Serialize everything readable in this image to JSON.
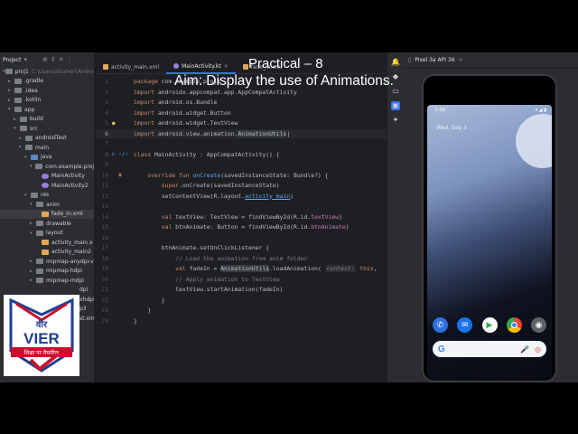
{
  "overlay": {
    "title": "Practical – 8",
    "aim": "Aim: Display the use of Animations."
  },
  "project_panel": {
    "header": "Project",
    "tree": [
      {
        "label": "proj1",
        "path": "C:\\Users\\shaheri\\AndroidS",
        "icon": "folder",
        "depth": 0,
        "expanded": true
      },
      {
        "label": ".gradle",
        "icon": "folder",
        "depth": 1
      },
      {
        "label": ".idea",
        "icon": "folder",
        "depth": 1
      },
      {
        "label": ".kotlin",
        "icon": "folder",
        "depth": 1
      },
      {
        "label": "app",
        "icon": "folder",
        "depth": 1,
        "expanded": true
      },
      {
        "label": "build",
        "icon": "folder",
        "depth": 2
      },
      {
        "label": "src",
        "icon": "folder",
        "depth": 2,
        "expanded": true
      },
      {
        "label": "androidTest",
        "icon": "folder",
        "depth": 3
      },
      {
        "label": "main",
        "icon": "folder",
        "depth": 3,
        "expanded": true
      },
      {
        "label": "java",
        "icon": "src",
        "depth": 4,
        "expanded": true
      },
      {
        "label": "com.example.proj",
        "icon": "folder",
        "depth": 5,
        "expanded": true
      },
      {
        "label": "MainActivity",
        "icon": "kt",
        "depth": 6
      },
      {
        "label": "MainActivity2",
        "icon": "kt",
        "depth": 6
      },
      {
        "label": "res",
        "icon": "folder",
        "depth": 4,
        "expanded": true
      },
      {
        "label": "anim",
        "icon": "folder",
        "depth": 5,
        "expanded": true
      },
      {
        "label": "fade_in.xml",
        "icon": "xml",
        "depth": 6,
        "selected": true
      },
      {
        "label": "drawable",
        "icon": "folder",
        "depth": 5
      },
      {
        "label": "layout",
        "icon": "folder",
        "depth": 5,
        "expanded": true
      },
      {
        "label": "activity_main.x",
        "icon": "xml",
        "depth": 6
      },
      {
        "label": "activity_main2",
        "icon": "xml",
        "depth": 6
      },
      {
        "label": "mipmap-anydpi-v",
        "icon": "folder",
        "depth": 5
      },
      {
        "label": "mipmap-hdpi",
        "icon": "folder",
        "depth": 5
      },
      {
        "label": "mipmap-mdpi",
        "icon": "folder",
        "depth": 5
      }
    ],
    "partial_rows": [
      "dpi",
      "xhdpi",
      "p3",
      "st.xml"
    ]
  },
  "tabs": [
    {
      "label": "activity_main.xml",
      "icon": "xml-file-icon",
      "active": false
    },
    {
      "label": "MainActivity.kt",
      "icon": "kotlin-file-icon",
      "active": true
    },
    {
      "label": "fade_in.xml",
      "icon": "xml-file-icon",
      "active": false
    }
  ],
  "editor": {
    "line_numbers": [
      "1",
      "2",
      "3",
      "4",
      "5",
      "6",
      "7",
      "8",
      "9",
      "10",
      "11",
      "12",
      "13",
      "14",
      "15",
      "16",
      "17",
      "18",
      "19",
      "20",
      "21",
      "22",
      "23",
      "24"
    ]
  },
  "emulator": {
    "device_tab": "Pixel 3a API 36",
    "status_time": "7:00",
    "date_text": "Wed, Sep 3",
    "search_logo": "G"
  },
  "logo": {
    "top_text": "वीर",
    "main_text": "VIER",
    "tagline": "शिक्षा पर वैचारिक"
  },
  "colors": {
    "editor_bg": "#1e1f22",
    "panel_bg": "#2b2d30",
    "keyword": "#cf8e6d",
    "function": "#56a8f5",
    "string": "#6aab73",
    "comment": "#7a7e85",
    "accent": "#3574f0"
  }
}
